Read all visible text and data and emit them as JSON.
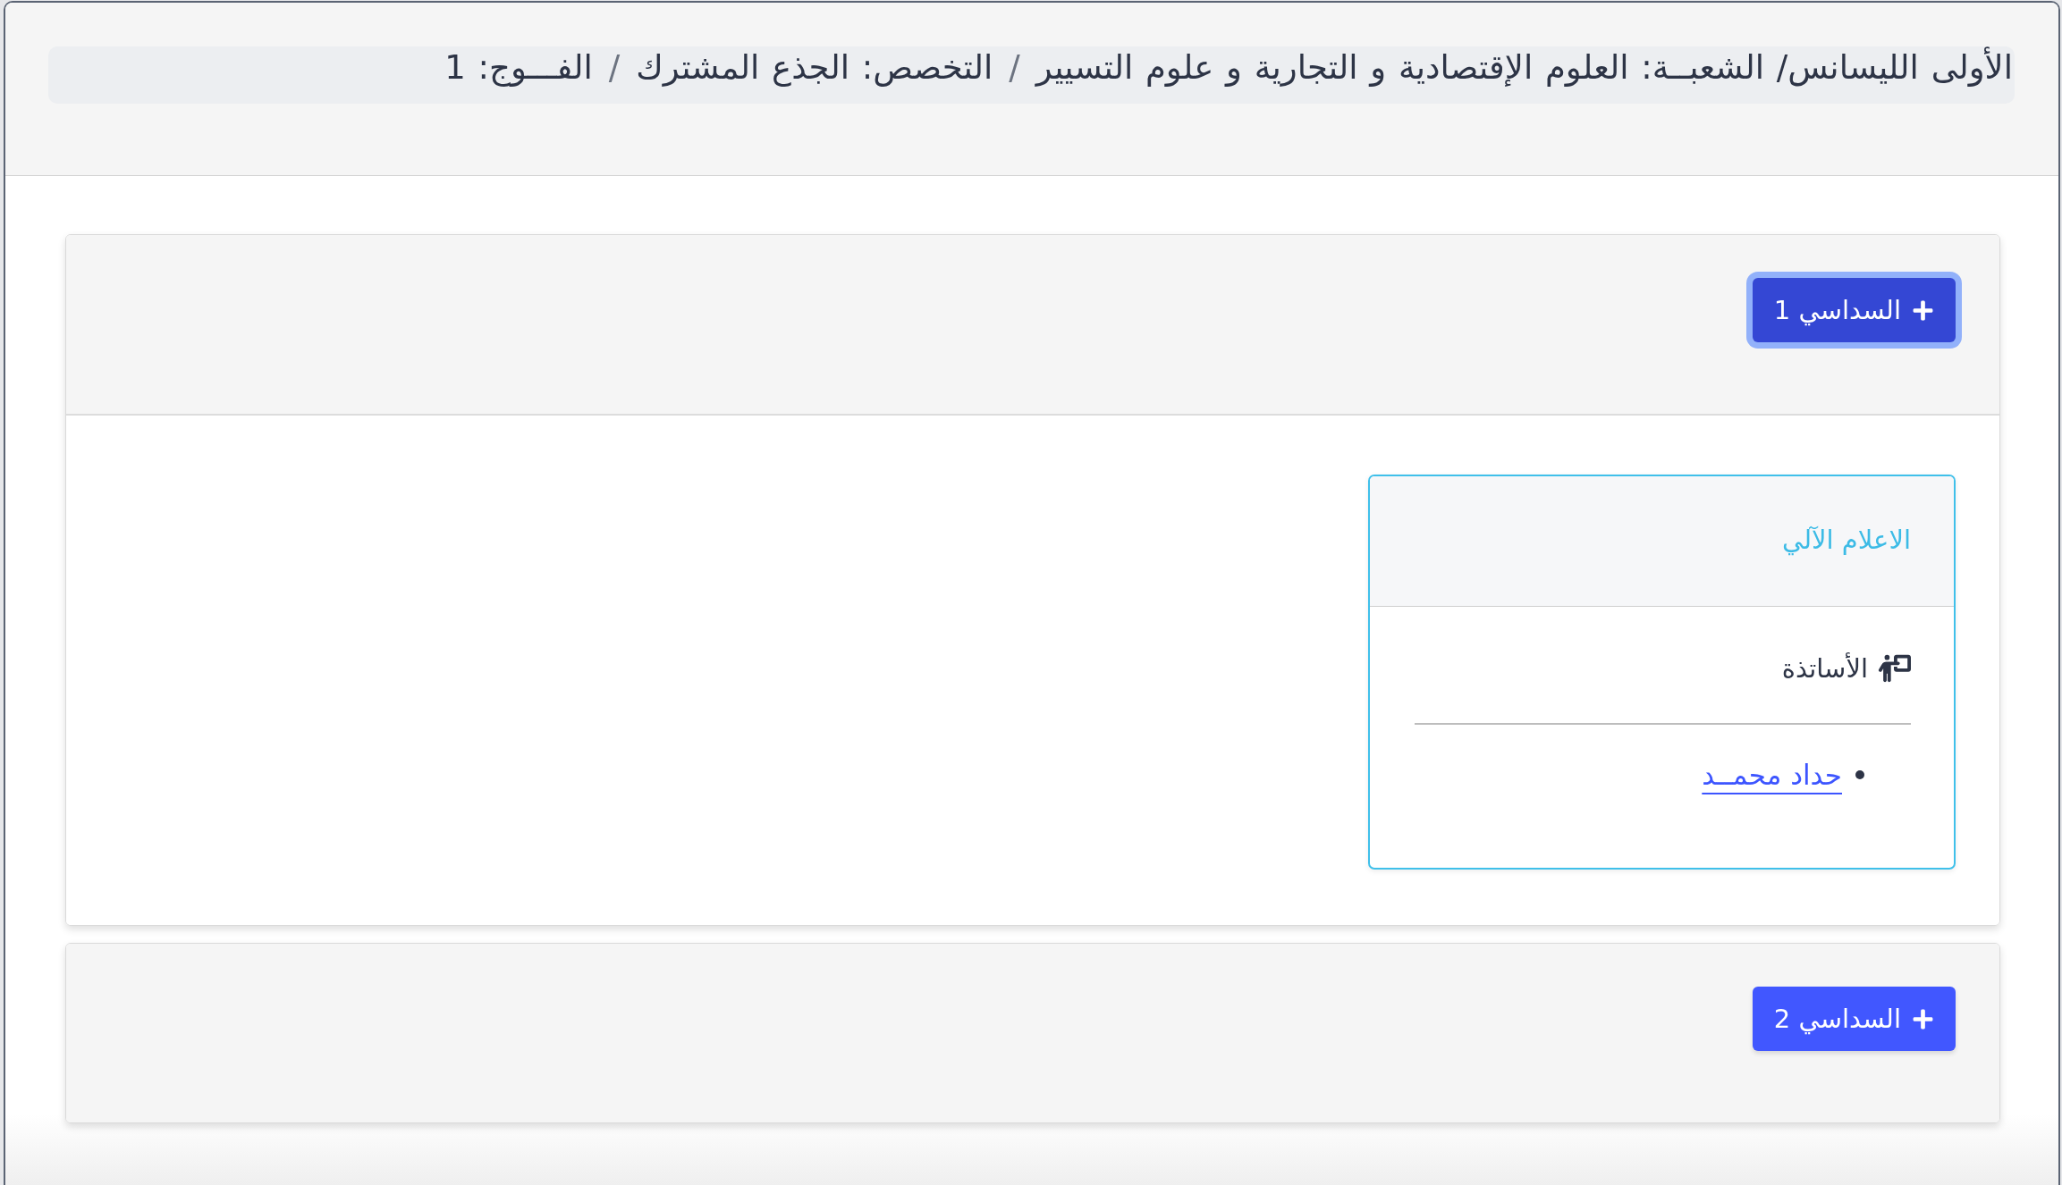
{
  "breadcrumb": {
    "items": [
      "الأولى الليسانس/ الشعبــة: العلوم الإقتصادية و التجارية و علوم التسيير",
      "التخصص: الجذع المشترك",
      "الفـــوج: 1"
    ],
    "separators": [
      "/",
      "/"
    ]
  },
  "semesters": [
    {
      "label": "السداسي 1",
      "active": true,
      "expanded": true,
      "modules": [
        {
          "title": "الاعلام الآلي",
          "section_label": "الأساتذة",
          "teachers": [
            "حداد محمــد"
          ]
        }
      ]
    },
    {
      "label": "السداسي 2",
      "active": false,
      "expanded": false
    }
  ]
}
